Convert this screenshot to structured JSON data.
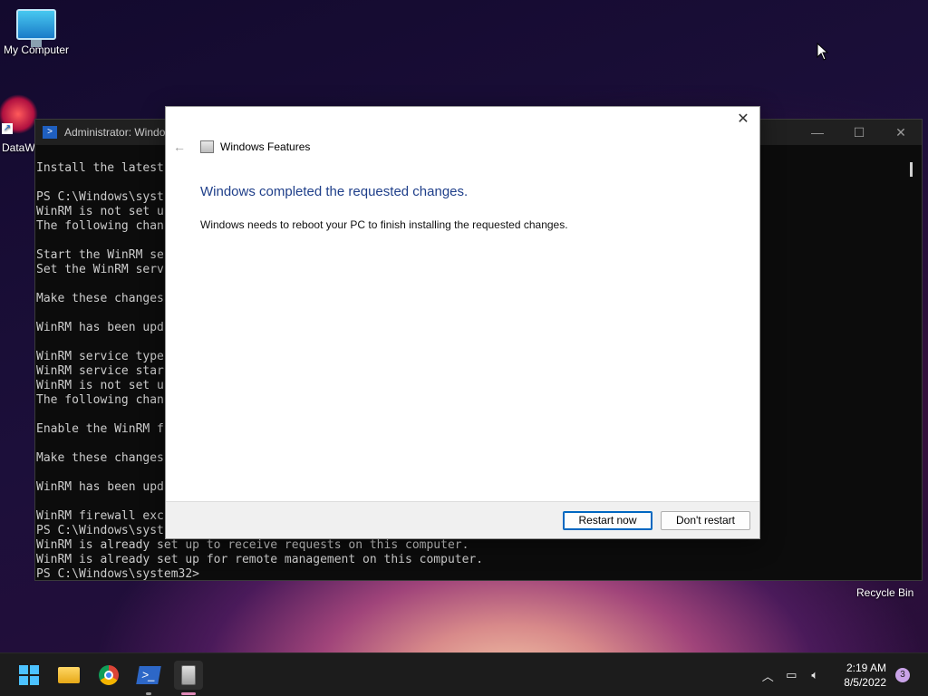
{
  "desktop": {
    "icons": [
      {
        "label": "My Computer"
      },
      {
        "label": "DataW"
      }
    ],
    "recycle_bin_label": "Recycle Bin"
  },
  "terminal": {
    "title": "Administrator: Windo",
    "console_lines": [
      "Install the latest",
      "",
      "PS C:\\Windows\\syst",
      "WinRM is not set u",
      "The following chan",
      "",
      "Start the WinRM se",
      "Set the WinRM serv",
      "",
      "Make these changes",
      "",
      "WinRM has been upd",
      "",
      "WinRM service type",
      "WinRM service star",
      "WinRM is not set u",
      "The following chan",
      "",
      "Enable the WinRM f",
      "",
      "Make these changes",
      "",
      "WinRM has been upd",
      "",
      "WinRM firewall exc",
      "PS C:\\Windows\\syst",
      "WinRM is already set up to receive requests on this computer.",
      "WinRM is already set up for remote management on this computer.",
      "PS C:\\Windows\\system32>"
    ]
  },
  "dialog": {
    "title": "Windows Features",
    "heading": "Windows completed the requested changes.",
    "message": "Windows needs to reboot your PC to finish installing the requested changes.",
    "restart_label": "Restart now",
    "dont_restart_label": "Don't restart"
  },
  "taskbar": {
    "apps": [
      "start-icon",
      "file-explorer-icon",
      "chrome-icon",
      "powershell-icon",
      "windows-features-icon"
    ],
    "clock_time": "2:19 AM",
    "clock_date": "8/5/2022",
    "notification_count": "3"
  },
  "colors": {
    "heading_blue": "#1f3f8a",
    "accent": "#0067c0",
    "start_blue": "#4cc2ff"
  }
}
